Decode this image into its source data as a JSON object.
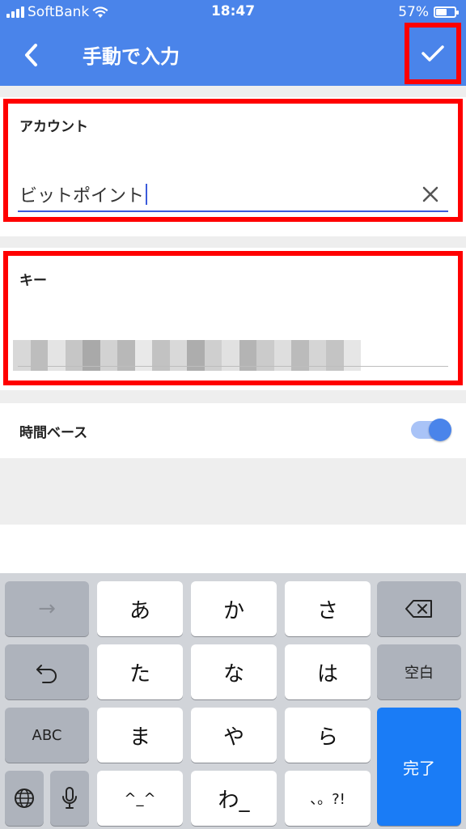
{
  "status_bar": {
    "carrier": "SoftBank",
    "time": "18:47",
    "battery_pct": "57%",
    "battery_level": 0.57,
    "icons": [
      "signal-icon",
      "wifi-icon",
      "battery-icon"
    ]
  },
  "app_bar": {
    "title": "手動で入力",
    "back_icon": "chevron-left-icon",
    "confirm_icon": "check-icon"
  },
  "account": {
    "label": "アカウント",
    "value": "ビットポイント",
    "clear_icon": "close-icon"
  },
  "key_field": {
    "label": "キー"
  },
  "time_based": {
    "label": "時間ベース",
    "enabled": true
  },
  "keyboard": {
    "rows": [
      [
        "→",
        "あ",
        "か",
        "さ",
        "⌫"
      ],
      [
        "↺",
        "た",
        "な",
        "は",
        "空白"
      ],
      [
        "ABC",
        "ま",
        "や",
        "ら",
        "完了"
      ],
      [
        "🌐",
        "🎤",
        "^_^",
        "わ_",
        "、。?!"
      ]
    ]
  },
  "colors": {
    "primary": "#4a84ea",
    "highlight": "#ff0000",
    "keyboard_done": "#1a7cf6"
  }
}
